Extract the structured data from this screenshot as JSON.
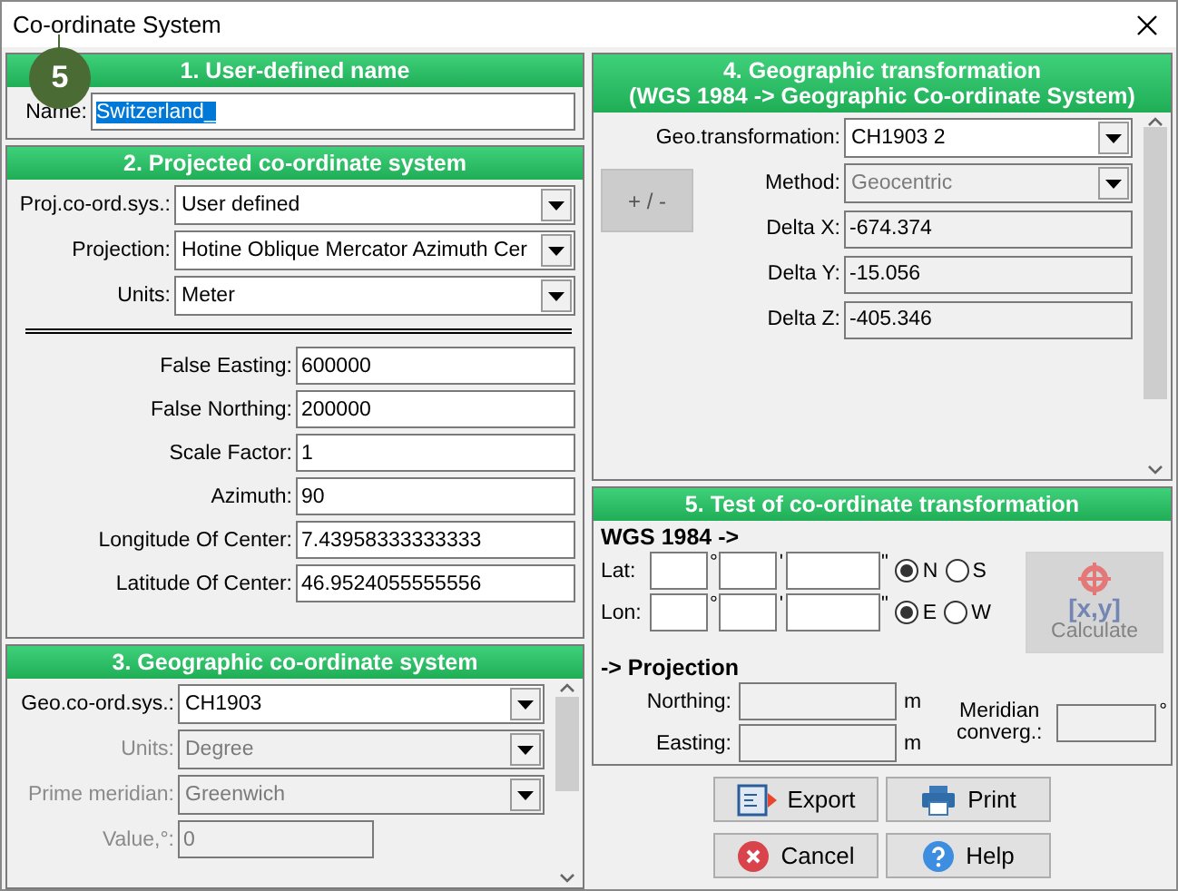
{
  "window": {
    "title": "Co-ordinate System"
  },
  "callout": {
    "label": "5"
  },
  "user_name": {
    "title": "1. User-defined name",
    "label": "Name:",
    "value": "Switzerland_",
    "selected": true
  },
  "projected": {
    "title": "2. Projected co-ordinate system",
    "selects": [
      {
        "label": "Proj.co-ord.sys.:",
        "value": "User defined",
        "disabled": false
      },
      {
        "label": "Projection:",
        "value": "Hotine Oblique Mercator Azimuth Cer",
        "disabled": false
      },
      {
        "label": "Units:",
        "value": "Meter",
        "disabled": false
      }
    ],
    "params": [
      {
        "label": "False Easting:",
        "value": "600000"
      },
      {
        "label": "False Northing:",
        "value": "200000"
      },
      {
        "label": "Scale Factor:",
        "value": "1"
      },
      {
        "label": "Azimuth:",
        "value": "90"
      },
      {
        "label": "Longitude Of Center:",
        "value": "7.43958333333333"
      },
      {
        "label": "Latitude Of Center:",
        "value": "46.9524055555556"
      }
    ]
  },
  "geographic": {
    "title": "3. Geographic co-ordinate system",
    "selects": [
      {
        "label": "Geo.co-ord.sys.:",
        "value": "CH1903",
        "disabled": false
      },
      {
        "label": "Units:",
        "value": "Degree",
        "disabled": true
      },
      {
        "label": "Prime meridian:",
        "value": "Greenwich",
        "disabled": true
      }
    ],
    "value_field": {
      "label": "Value,°:",
      "value": "0",
      "disabled": true
    }
  },
  "transformation": {
    "title": "4. Geographic transformation",
    "subtitle": "(WGS 1984 -> Geographic Co-ordinate System)",
    "edit_button": {
      "label": "+ / -",
      "disabled": true
    },
    "selects": [
      {
        "label": "Geo.transformation:",
        "value": "CH1903 2",
        "disabled": false
      },
      {
        "label": "Method:",
        "value": "Geocentric",
        "disabled": true
      }
    ],
    "deltas": [
      {
        "label": "Delta X:",
        "value": "-674.374"
      },
      {
        "label": "Delta Y:",
        "value": "-15.056"
      },
      {
        "label": "Delta Z:",
        "value": "-405.346"
      }
    ]
  },
  "test": {
    "title": "5. Test of co-ordinate transformation",
    "source_heading": "WGS 1984 ->",
    "coords": [
      {
        "label": "Lat:",
        "deg_mark": "°",
        "min_mark": "'",
        "sec_mark": "\"",
        "options": [
          {
            "label": "N",
            "selected": true
          },
          {
            "label": "S",
            "selected": false
          }
        ]
      },
      {
        "label": "Lon:",
        "deg_mark": "°",
        "min_mark": "'",
        "sec_mark": "\"",
        "options": [
          {
            "label": "E",
            "selected": true
          },
          {
            "label": "W",
            "selected": false
          }
        ]
      }
    ],
    "calculate": {
      "icon_text": "[x,y]",
      "label": "Calculate",
      "disabled": true
    },
    "target_heading": "-> Projection",
    "outputs": [
      {
        "label": "Northing:",
        "unit": "m"
      },
      {
        "label": "Easting:",
        "unit": "m"
      }
    ],
    "convergence": {
      "label": "Meridian converg.:",
      "unit": "°"
    }
  },
  "buttons": [
    {
      "label": "Export",
      "kind": "export"
    },
    {
      "label": "Print",
      "kind": "print"
    },
    {
      "label": "Cancel",
      "kind": "cancel"
    },
    {
      "label": "Help",
      "kind": "help"
    }
  ]
}
